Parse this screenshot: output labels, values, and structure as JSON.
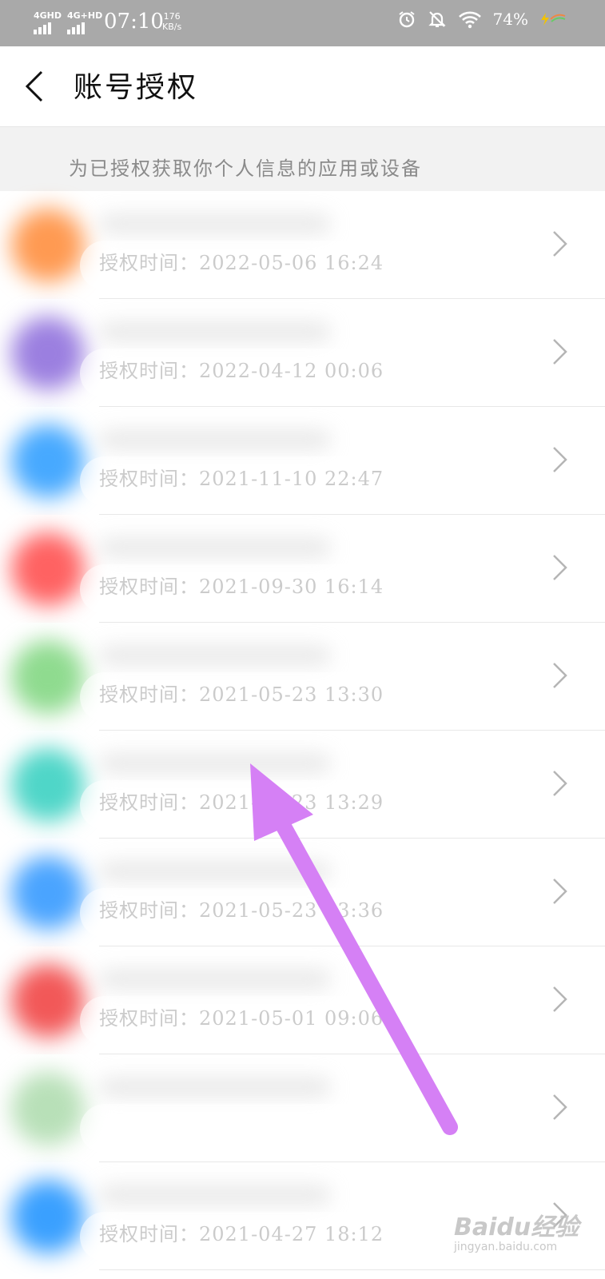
{
  "status_bar": {
    "sig1": "4GHD",
    "sig2": "4G+HD",
    "time": "07:10",
    "speed_value": "176",
    "speed_unit": "KB/s",
    "battery": "74%",
    "icons": [
      "alarm-icon",
      "bell-muted-icon",
      "wifi-icon",
      "battery-icon",
      "charging-icon"
    ]
  },
  "header": {
    "title": "账号授权"
  },
  "section": {
    "description": "为已授权获取你个人信息的应用或设备"
  },
  "auth_prefix": "授权时间：",
  "apps": [
    {
      "color": "#ff9a52",
      "time": "授权时间：2022-05-06 16:24"
    },
    {
      "color": "#9b7fe0",
      "time": "授权时间：2022-04-12 00:06"
    },
    {
      "color": "#47a9ff",
      "time": "授权时间：2021-11-10 22:47"
    },
    {
      "color": "#ff6262",
      "time": "授权时间：2021-09-30 16:14"
    },
    {
      "color": "#8fdb8f",
      "time": "授权时间：2021-05-23 13:30"
    },
    {
      "color": "#4fd6c8",
      "time": "授权时间：2021-05-23 13:29"
    },
    {
      "color": "#4aa4ff",
      "time": "授权时间：2021-05-23 13:36"
    },
    {
      "color": "#f25858",
      "time": "授权时间：2021-05-01 09:06"
    },
    {
      "color": "#b8e0b8",
      "time": ""
    },
    {
      "color": "#3aa0ff",
      "time": "授权时间：2021-04-27 18:12"
    }
  ],
  "annotation": {
    "arrow_color": "#d580f5"
  },
  "watermark": {
    "brand": "Baidu经验",
    "url": "jingyan.baidu.com"
  }
}
